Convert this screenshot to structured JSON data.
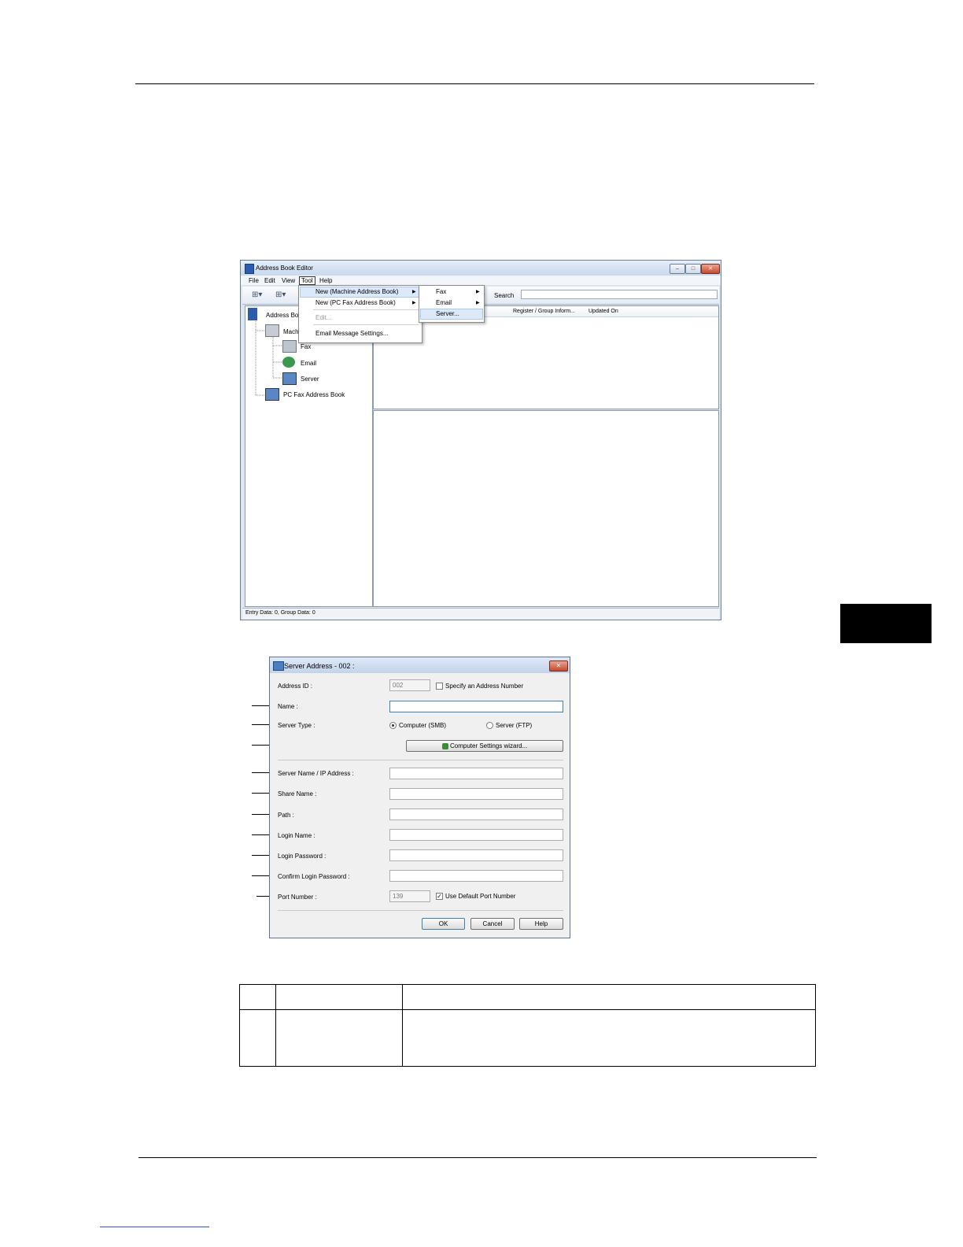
{
  "editor": {
    "title": "Address Book Editor",
    "menus": [
      "File",
      "Edit",
      "View",
      "Tool",
      "Help"
    ],
    "search_label": "Search",
    "columns": [
      "Register / Group Inform...",
      "Updated On"
    ],
    "tool_menu": [
      "New (Machine Address Book)",
      "New (PC Fax Address Book)",
      "Edit...",
      "Email Message Settings..."
    ],
    "submenu": [
      "Fax",
      "Email",
      "Server..."
    ],
    "tree": {
      "root": "Address Boo",
      "machine": "Mach",
      "fax": "Fax",
      "email": "Email",
      "server": "Server",
      "pcfax": "PC Fax Address Book"
    },
    "status": "Entry Data: 0, Group Data: 0",
    "window_buttons": [
      "–",
      "□",
      "✕"
    ]
  },
  "dialog": {
    "title": "Server Address - 002 :",
    "address_id_label": "Address ID :",
    "address_id_value": "002",
    "specify_label": "Specify an Address Number",
    "name_label": "Name :",
    "server_type_label": "Server Type :",
    "radio_smb": "Computer (SMB)",
    "radio_ftp": "Server (FTP)",
    "wizard_button": "Computer Settings wizard...",
    "server_name_label": "Server Name / IP Address :",
    "share_name_label": "Share Name :",
    "path_label": "Path :",
    "login_name_label": "Login Name :",
    "login_password_label": "Login Password :",
    "confirm_password_label": "Confirm Login Password :",
    "port_label": "Port Number :",
    "port_value": "139",
    "use_default_port_label": "Use Default Port Number",
    "ok": "OK",
    "cancel": "Cancel",
    "help": "Help",
    "close": "✕"
  }
}
